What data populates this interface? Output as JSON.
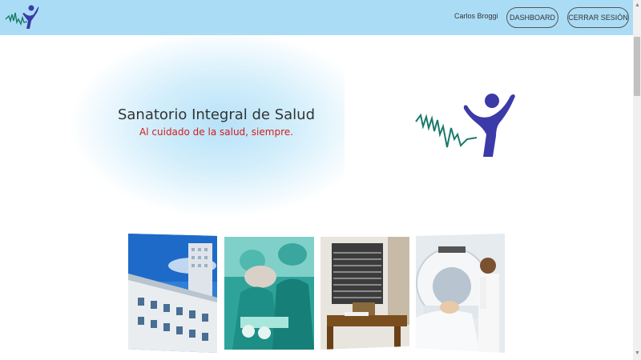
{
  "navbar": {
    "user_name": "Carlos Broggi",
    "dashboard_label": "DASHBOARD",
    "logout_label": "CERRAR SESIÓN",
    "background": "#abdcf5"
  },
  "hero": {
    "title": "Sanatorio Integral de Salud",
    "subtitle": "Al cuidado de la salud, siempre.",
    "subtitle_color": "#d41c1c"
  },
  "brand": {
    "logo_icon": "heartbeat-person-logo",
    "line_color": "#1a7a6a",
    "figure_color": "#3b3aa8"
  },
  "gallery": {
    "photos": [
      {
        "icon": "hospital-building-photo"
      },
      {
        "icon": "surgery-team-photo"
      },
      {
        "icon": "consulting-room-photo"
      },
      {
        "icon": "ct-scanner-photo"
      }
    ]
  }
}
